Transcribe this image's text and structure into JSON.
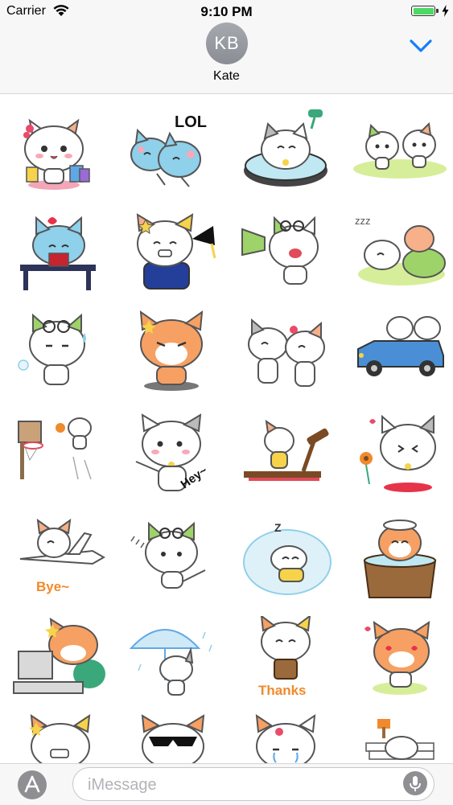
{
  "status_bar": {
    "carrier": "Carrier",
    "time": "9:10 PM",
    "battery_level": 1.0
  },
  "header": {
    "avatar_initials": "KB",
    "contact_name": "Kate",
    "collapse_icon": "chevron-down-icon",
    "accent_color": "#157efb"
  },
  "stickers": {
    "captions": {
      "lol": "LOL",
      "hey": "Hey~",
      "bye": "Bye~",
      "zzz": "zzz",
      "thanks": "Thanks"
    },
    "items": [
      "shopping-cat-sticker",
      "lol-cats-sticker",
      "bath-cat-sticker",
      "two-cats-meadow-sticker",
      "reading-cat-sticker",
      "graduate-cat-sticker",
      "megaphone-cat-sticker",
      "sleeping-cats-sticker",
      "sweating-cat-sticker",
      "angry-cat-sticker",
      "crying-cats-sticker",
      "car-cats-sticker",
      "basketball-cat-sticker",
      "hey-cat-sticker",
      "treadmill-cat-sticker",
      "flower-cat-sticker",
      "airplane-cat-sticker",
      "jump-cat-sticker",
      "cloud-sleep-cat-sticker",
      "tub-cat-sticker",
      "computer-cat-sticker",
      "umbrella-cat-sticker",
      "thanks-cat-sticker",
      "love-cat-sticker",
      "grin-cat-sticker",
      "sunglasses-cat-sticker",
      "tearful-cat-sticker",
      "books-cat-sticker"
    ]
  },
  "compose": {
    "placeholder": "iMessage",
    "value": "",
    "app_icon": "app-store-icon",
    "mic_icon": "microphone-icon"
  }
}
